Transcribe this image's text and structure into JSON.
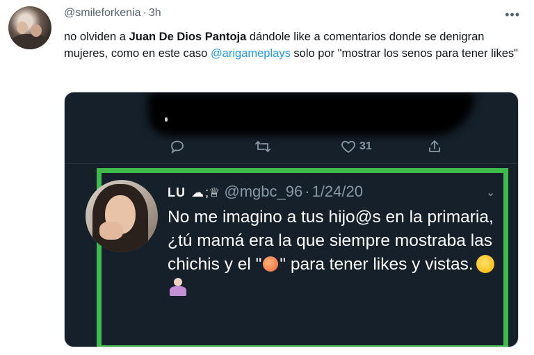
{
  "tweet": {
    "handle": "@smileforkenia",
    "separator": "·",
    "time": "3h",
    "text_before_bold": "no olviden a ",
    "bold_name": "Juan De Dios Pantoja",
    "text_after_bold": " dándole like a comentarios donde se denigran mujeres, como en este caso ",
    "mention": "@arigameplays",
    "text_end": " solo por \"mostrar los senos para tener likes\""
  },
  "media": {
    "embedded_actions": {
      "like_count": "31"
    },
    "quoted": {
      "name": "LU",
      "extra_symbol": ";♕",
      "handle": "@mgbc_96",
      "separator": "·",
      "date": "1/24/20",
      "text_line_1": "No me imagino a tus hijo@s en la primaria, ¿tú mamá era la que siempre mostraba las chichis y el \"",
      "text_line_2": "\" para tener likes y vistas."
    }
  },
  "icons": {
    "more": "more-horizontal-icon",
    "reply": "reply-icon",
    "retweet": "retweet-icon",
    "like": "heart-icon",
    "share": "share-icon",
    "chevron": "chevron-down-icon"
  },
  "colors": {
    "mention": "#1d9bf0",
    "frame_green": "#3fba4c",
    "dark_bg": "#15202b"
  }
}
